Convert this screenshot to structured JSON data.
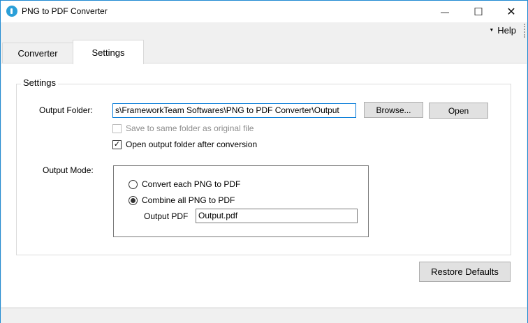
{
  "window": {
    "title": "PNG to PDF Converter",
    "accent_color": "#1f8ad2",
    "icon": "app-icon",
    "controls": {
      "minimize": "—",
      "maximize": "☐",
      "close": "✕"
    }
  },
  "menu": {
    "help_label": "Help"
  },
  "tabs": [
    {
      "label": "Converter",
      "active": false
    },
    {
      "label": "Settings",
      "active": true
    }
  ],
  "settings": {
    "group_title": "Settings",
    "output_folder_label": "Output Folder:",
    "output_folder_value": "s\\FrameworkTeam Softwares\\PNG to PDF Converter\\Output",
    "browse_label": "Browse...",
    "open_label": "Open",
    "same_folder_label": "Save to same folder as original file",
    "same_folder_checked": false,
    "same_folder_enabled": false,
    "open_after_label": "Open output folder after conversion",
    "open_after_checked": true,
    "output_mode_label": "Output Mode:",
    "mode_each_label": "Convert each PNG to PDF",
    "mode_combine_label": "Combine all PNG to PDF",
    "selected_mode": "combine",
    "output_pdf_label": "Output PDF",
    "output_pdf_value": "Output.pdf",
    "restore_label": "Restore Defaults"
  }
}
